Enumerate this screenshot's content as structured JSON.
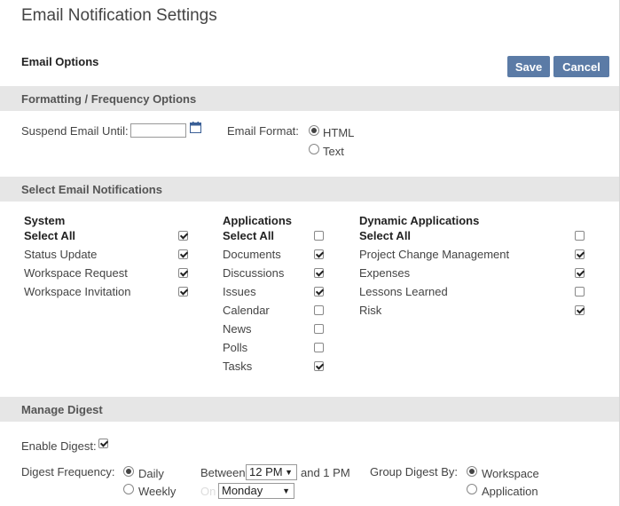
{
  "header": {
    "title": "Email Notification Settings",
    "section_label": "Email Options",
    "save_label": "Save",
    "cancel_label": "Cancel"
  },
  "formatting": {
    "band_title": "Formatting / Frequency Options",
    "suspend_label": "Suspend Email Until:",
    "suspend_value": "",
    "format_label": "Email Format:",
    "format_options": [
      "HTML",
      "Text"
    ],
    "format_selected": "HTML"
  },
  "notifications": {
    "band_title": "Select Email Notifications",
    "columns": [
      {
        "title": "System",
        "select_all_label": "Select All",
        "select_all_checked": true,
        "items": [
          {
            "label": "Status Update",
            "checked": true
          },
          {
            "label": "Workspace Request",
            "checked": true
          },
          {
            "label": "Workspace Invitation",
            "checked": true
          }
        ]
      },
      {
        "title": "Applications",
        "select_all_label": "Select All",
        "select_all_checked": false,
        "items": [
          {
            "label": "Documents",
            "checked": true
          },
          {
            "label": "Discussions",
            "checked": true
          },
          {
            "label": "Issues",
            "checked": true
          },
          {
            "label": "Calendar",
            "checked": false
          },
          {
            "label": "News",
            "checked": false
          },
          {
            "label": "Polls",
            "checked": false
          },
          {
            "label": "Tasks",
            "checked": true
          }
        ]
      },
      {
        "title": "Dynamic Applications",
        "select_all_label": "Select All",
        "select_all_checked": false,
        "items": [
          {
            "label": "Project Change Management",
            "checked": true
          },
          {
            "label": "Expenses",
            "checked": true
          },
          {
            "label": "Lessons Learned",
            "checked": false
          },
          {
            "label": "Risk",
            "checked": true
          }
        ]
      }
    ]
  },
  "digest": {
    "band_title": "Manage Digest",
    "enable_label": "Enable Digest:",
    "enable_checked": true,
    "frequency_label": "Digest Frequency:",
    "frequency_options": [
      "Daily",
      "Weekly"
    ],
    "frequency_selected": "Daily",
    "between_label": "Between",
    "between_value": "12 PM",
    "between_suffix": "and 1 PM",
    "on_label": "On",
    "on_value": "Monday",
    "group_label": "Group Digest By:",
    "group_options": [
      "Workspace",
      "Application"
    ],
    "group_selected": "Workspace"
  },
  "colors": {
    "button": "#5b7ba6",
    "band": "#e6e6e6",
    "calendar_icon": "#3a5f96"
  },
  "icons": {
    "calendar": "calendar-icon",
    "dropdown": "chevron-down-icon"
  }
}
